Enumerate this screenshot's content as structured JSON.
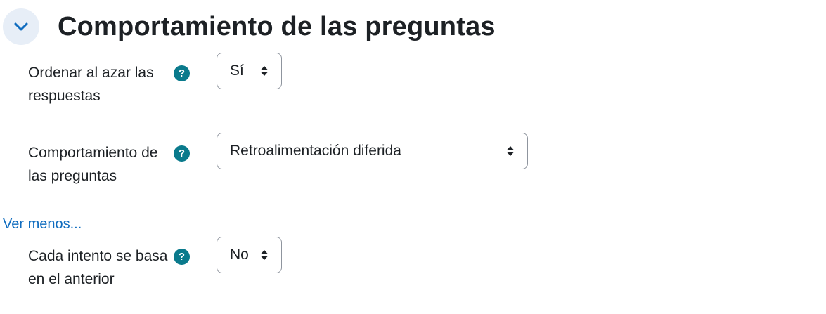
{
  "section": {
    "title": "Comportamiento de las preguntas",
    "toggle_icon": "chevron-down-icon"
  },
  "fields": [
    {
      "label": "Ordenar al azar las respuestas",
      "help_icon": "question-circle-icon",
      "help_glyph": "?",
      "value": "Sí"
    },
    {
      "label": "Comportamiento de las preguntas",
      "help_icon": "question-circle-icon",
      "help_glyph": "?",
      "value": "Retroalimentación diferida"
    },
    {
      "label": "Cada intento se basa en el anterior",
      "help_icon": "question-circle-icon",
      "help_glyph": "?",
      "value": "No"
    }
  ],
  "show_less_link": "Ver menos...",
  "colors": {
    "link": "#0f6cbf",
    "help_icon_bg": "#0a7a8c",
    "toggle_bg": "#e7eef7",
    "text": "#1d2125",
    "border": "#8f959e"
  }
}
